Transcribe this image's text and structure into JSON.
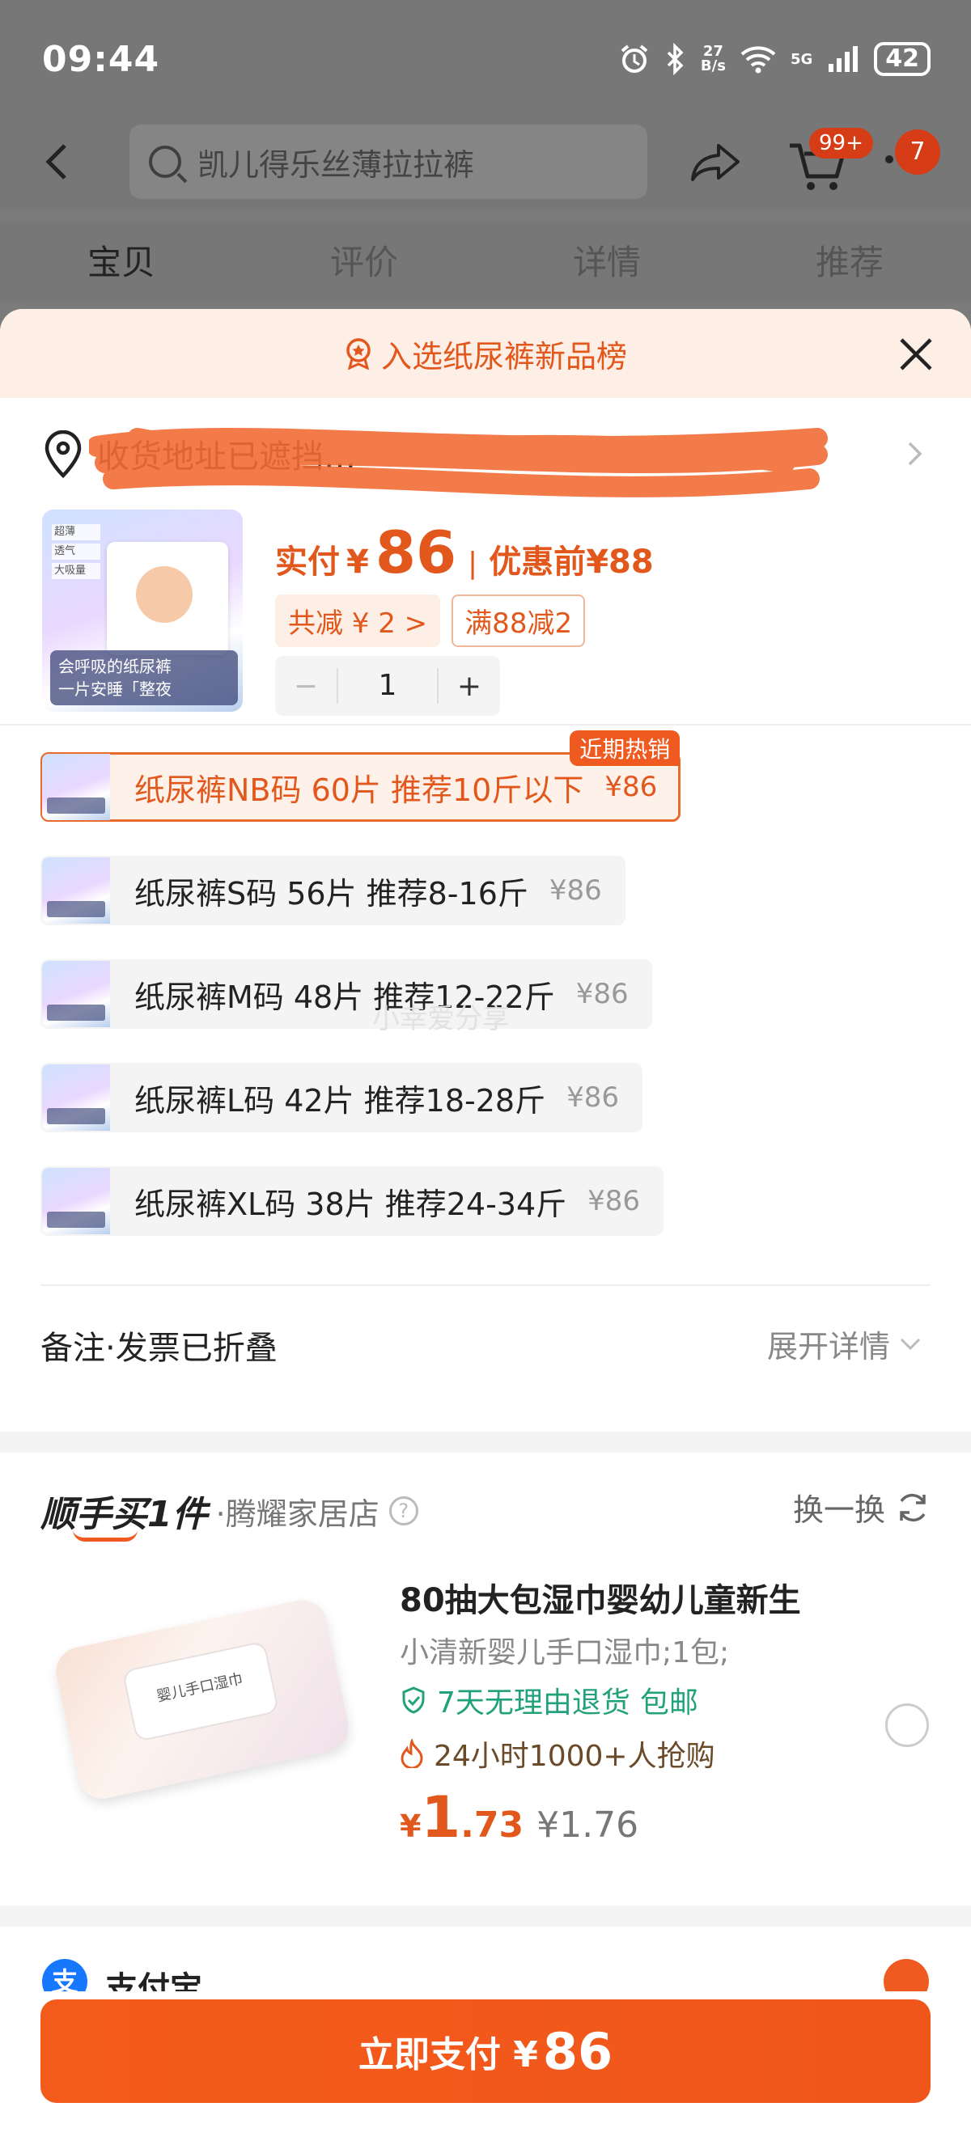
{
  "status_bar": {
    "time": "09:44",
    "net_speed_value": "27",
    "net_speed_unit": "B/s",
    "signal": "5G",
    "battery": "42"
  },
  "topnav": {
    "search_placeholder": "凯儿得乐丝薄拉拉裤",
    "cart_badge": "99+",
    "message_badge": "7"
  },
  "tabs": [
    "宝贝",
    "评价",
    "详情",
    "推荐"
  ],
  "sheet": {
    "banner": "入选纸尿裤新品榜",
    "address": "收货地址已遮挡…"
  },
  "product": {
    "thumb_caption_line1": "会呼吸的纸尿裤",
    "thumb_caption_line2": "一片安睡「整夜",
    "thumb_tags": [
      "超薄",
      "透气",
      "大吸量"
    ],
    "price_label": "实付",
    "currency": "¥",
    "price": "86",
    "before_label": "优惠前",
    "before_price": "¥88",
    "discount_chip": "共减 ¥ 2 >",
    "coupon_chip": "满88减2",
    "stepper_minus": "−",
    "quantity": "1",
    "stepper_plus": "+"
  },
  "skus": [
    {
      "label": "纸尿裤NB码 60片 推荐10斤以下",
      "price": "¥86",
      "tag": "近期热销"
    },
    {
      "label": "纸尿裤S码 56片 推荐8-16斤",
      "price": "¥86"
    },
    {
      "label": "纸尿裤M码 48片 推荐12-22斤",
      "price": "¥86"
    },
    {
      "label": "纸尿裤L码 42片 推荐18-28斤",
      "price": "¥86"
    },
    {
      "label": "纸尿裤XL码 38片 推荐24-34斤",
      "price": "¥86"
    }
  ],
  "watermark": "小幸爱分享",
  "remark": {
    "label": "备注·发票已折叠",
    "expand": "展开详情"
  },
  "upsell": {
    "brand": "顺手买1件",
    "shop": "·腾耀家居店",
    "help": "?",
    "swap": "换一换",
    "pack_text": "婴儿手口湿巾",
    "name": "80抽大包湿巾婴幼儿童新生",
    "spec": "小清新婴儿手口湿巾;1包;",
    "return_tag": "7天无理由退货",
    "shipping_tag": "包邮",
    "hot": "24小时1000+人抢购",
    "currency": "¥",
    "price_int": "1",
    "price_dec": ".73",
    "orig_price": "¥1.76"
  },
  "payment": {
    "method_icon": "支",
    "method": "支付宝"
  },
  "pay_button": {
    "label": "立即支付 ¥",
    "amount": "86"
  },
  "colors": {
    "accent": "#ee5a1f",
    "price": "#e2581c",
    "green": "#21a27a",
    "overlay": "#777777"
  }
}
